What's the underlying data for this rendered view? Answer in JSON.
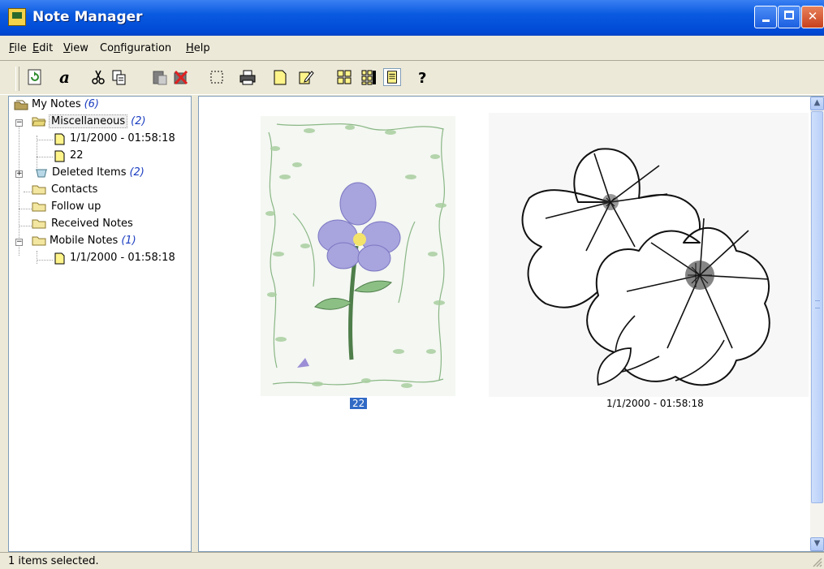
{
  "window": {
    "title": "Note Manager"
  },
  "menubar": {
    "items": [
      {
        "label": "File",
        "mnemonic": "F",
        "rest": "ile"
      },
      {
        "label": "Edit",
        "mnemonic": "E",
        "rest": "dit"
      },
      {
        "label": "View",
        "mnemonic": "V",
        "rest": "iew"
      },
      {
        "label": "Configuration",
        "pre": "Co",
        "mnemonic": "n",
        "rest": "figuration"
      },
      {
        "label": "Help",
        "mnemonic": "H",
        "rest": "elp"
      }
    ]
  },
  "toolbar": {
    "buttons": [
      "refresh-icon",
      "font-icon",
      "cut-icon",
      "copy-icon",
      "paste-icon",
      "delete-icon",
      "select-icon",
      "print-icon",
      "new-note-icon",
      "edit-note-icon",
      "large-icons-icon",
      "small-icons-icon",
      "thumbnail-view-icon",
      "help-icon"
    ]
  },
  "tree": {
    "root": {
      "label": "My Notes",
      "count": "(6)"
    },
    "misc": {
      "label": "Miscellaneous",
      "count": "(2)"
    },
    "misc_child1": {
      "label": "1/1/2000 - 01:58:18"
    },
    "misc_child2": {
      "label": "22"
    },
    "deleted": {
      "label": "Deleted Items",
      "count": "(2)"
    },
    "contacts": {
      "label": "Contacts"
    },
    "followup": {
      "label": "Follow up"
    },
    "received": {
      "label": "Received Notes"
    },
    "mobile": {
      "label": "Mobile Notes",
      "count": "(1)"
    },
    "mobile_child1": {
      "label": "1/1/2000 - 01:58:18"
    }
  },
  "thumbnails": [
    {
      "caption": "22",
      "selected": true
    },
    {
      "caption": "1/1/2000 - 01:58:18",
      "selected": false
    }
  ],
  "status": {
    "text": "1 items selected."
  },
  "colors": {
    "titlebar": "#0A5AE0",
    "selection": "#316AC5",
    "count_text": "#1A3DC0"
  }
}
